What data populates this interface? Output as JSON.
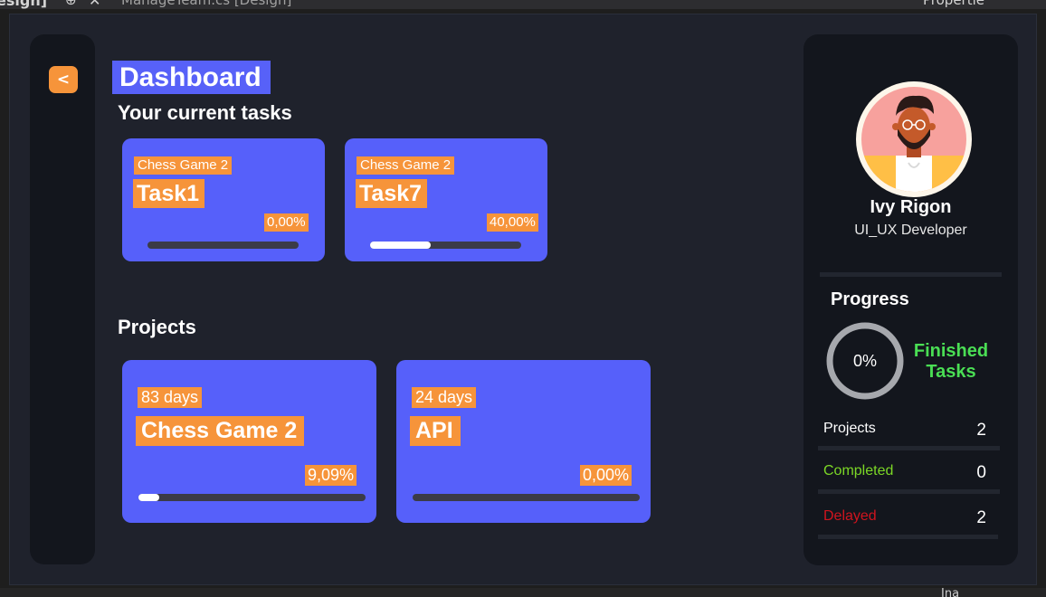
{
  "ide": {
    "tab_text_left": "esign]",
    "tab_text_file": "ManageTeam.cs [Design]",
    "tab_text_right": "Propertie",
    "bottom_text": "Ina"
  },
  "nav": {
    "back_label": "<"
  },
  "page_title": "Dashboard",
  "tasks": {
    "heading": "Your current tasks",
    "items": [
      {
        "project": "Chess Game 2",
        "name": "Task1",
        "percent_label": "0,00%",
        "progress": 0.0
      },
      {
        "project": "Chess Game 2",
        "name": "Task7",
        "percent_label": "40,00%",
        "progress": 0.4
      }
    ]
  },
  "projects": {
    "heading": "Projects",
    "items": [
      {
        "days": "83 days",
        "name": "Chess Game 2",
        "percent_label": "9,09%",
        "progress": 0.0909
      },
      {
        "days": "24 days",
        "name": "API",
        "percent_label": "0,00%",
        "progress": 0.0
      }
    ]
  },
  "profile": {
    "name": "Ivy Rigon",
    "role": "UI_UX Developer"
  },
  "progress_panel": {
    "title": "Progress",
    "ring_label": "0%",
    "finished_line1": "Finished",
    "finished_line2": "Tasks",
    "stats": [
      {
        "label": "Projects",
        "value": "2",
        "color": "#ffffff"
      },
      {
        "label": "Completed",
        "value": "0",
        "color": "#7cd826"
      },
      {
        "label": "Delayed",
        "value": "2",
        "color": "#d0141e"
      }
    ]
  },
  "colors": {
    "accent_blue": "#5660fa",
    "accent_orange": "#f6943a",
    "panel_bg": "#13161d",
    "window_bg": "#1f222c",
    "success_green": "#4ade54"
  }
}
